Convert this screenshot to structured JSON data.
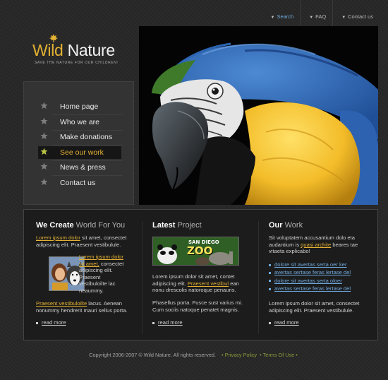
{
  "topnav": {
    "items": [
      "Search",
      "FAQ",
      "Contact us"
    ]
  },
  "logo": {
    "word1": "Wild",
    "word2": "Nature",
    "tagline": "SAVE THE NATURE FOR OUR CHILDREN!"
  },
  "menu": {
    "items": [
      "Home page",
      "Who we are",
      "Make  donations",
      "See our work",
      "News & press",
      "Contact us"
    ],
    "active_index": 3
  },
  "col1": {
    "heading_bold": "We Create",
    "heading_light": "World For You",
    "p1_link": "Lorem ipsum dolor",
    "p1_rest": " sit amet, consectet adipiscing elit. Praesent vestibulule.",
    "p2_link": "Lorem ipsum dolor sit amet,",
    "p2_rest": " consectet adipiscing elit. Praesent vestibuloilte lac neaummy.",
    "p3_link": "Praesent vestibuloilte",
    "p3_rest": " lacus. Aenean nonummy hendrerit mauri sellus porta.",
    "read_more": "read more"
  },
  "col2": {
    "heading_bold": "Latest",
    "heading_light": "Project",
    "zoo_line1": "SAN DIEGO",
    "zoo_line2": "ZOO",
    "p1_a": "Lorem ipsum dolor sit amet, contet adipiscing elit. ",
    "p1_link": "Praesent vestibul",
    "p1_b": " ean nonu drescolis natoroque penauris.",
    "p2": "Phasellus porta. Fusce sust varius mi. Cum sociis natoque penatet magnis.",
    "read_more": "read more"
  },
  "col3": {
    "heading_bold": "Our",
    "heading_light": "Work",
    "p1_a": "Sit voluptatem accusantium dolo eta audantium is ",
    "p1_link": "quasi archite",
    "p1_b": " beares tae vitaeta explicabo!",
    "links": [
      "dolore sit avertas serta oer ker",
      "avertas sertase feras lertase del",
      "dolore sit avertas serta oloer",
      "avertas sertase feras lertase del"
    ],
    "p2": "Lorem ipsum dolor sit amet, consectet adipiscing elit. Praesent vestibulule.",
    "read_more": "read more"
  },
  "footer": {
    "copyright": "Copyright 2006-2007 © Wild Nature.  All rights reserved.",
    "privacy": "Privacy Policy",
    "terms": "Terms Of Use"
  },
  "colors": {
    "accent": "#e3b133",
    "link_blue": "#6fa8dc",
    "footer_link": "#8a9c3a"
  },
  "icons": [
    "arrow-down-icon",
    "leaf-icon",
    "star-icon",
    "bullet-icon"
  ]
}
